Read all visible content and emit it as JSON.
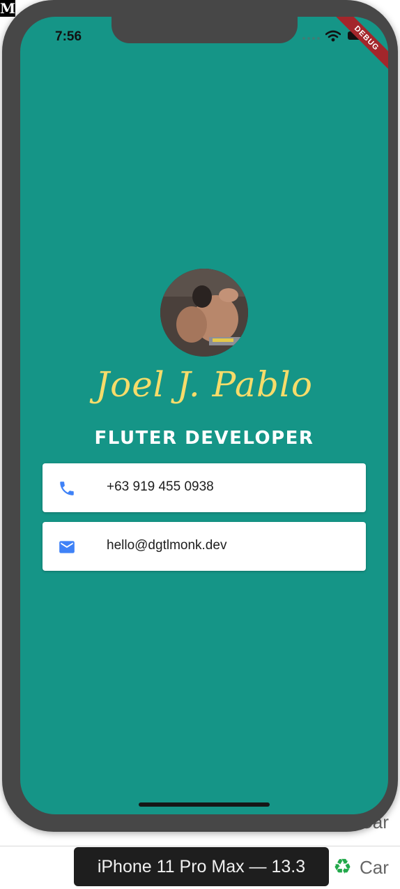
{
  "status_bar": {
    "time": "7:56",
    "debug_banner": "DEBUG"
  },
  "profile": {
    "name": "Joel J. Pablo",
    "title": "FLUTER DEVELOPER"
  },
  "contacts": [
    {
      "icon": "phone-icon",
      "text": "+63 919 455 0938"
    },
    {
      "icon": "mail-icon",
      "text": "hello@dgtlmonk.dev"
    }
  ],
  "simulator": {
    "device_label": "iPhone 11 Pro Max — 13.3"
  },
  "background": {
    "row_text_1": "Car",
    "row_text_2": "Car",
    "logo_letter": "M"
  },
  "colors": {
    "screen_bg": "#159587",
    "name_color": "#f6dc6a",
    "icon_blue": "#3f82f7"
  }
}
